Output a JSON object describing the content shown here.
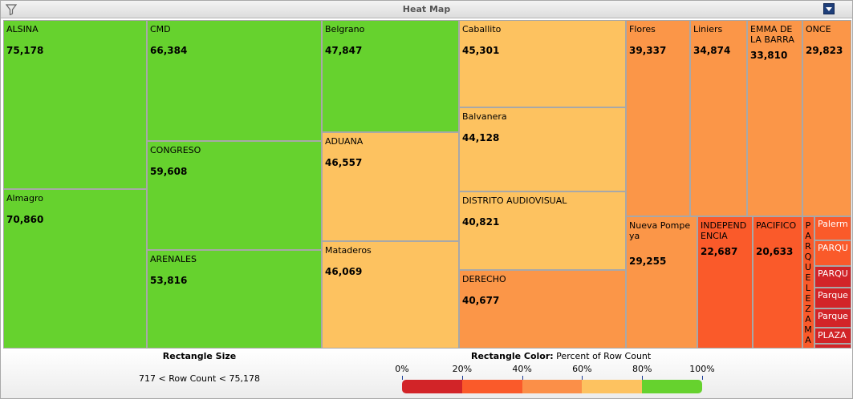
{
  "window": {
    "title": "Heat Map"
  },
  "legend": {
    "size_heading": "Rectangle Size",
    "size_text": "717 < Row Count < 75,178",
    "color_heading": "Rectangle Color:",
    "color_measure": " Percent of Row Count",
    "ticks": [
      "0%",
      "20%",
      "40%",
      "60%",
      "80%",
      "100%"
    ],
    "colors": [
      "#d22428",
      "#fa5a2a",
      "#fb8f48",
      "#fdc260",
      "#66d22e"
    ]
  },
  "chart_data": {
    "type": "treemap",
    "title": "Heat Map",
    "size_measure": "Row Count",
    "size_range": [
      717,
      75178
    ],
    "color_measure": "Percent of Row Count",
    "color_scale": [
      {
        "from": 0,
        "to": 20,
        "color": "#d22428"
      },
      {
        "from": 20,
        "to": 40,
        "color": "#fa5a2a"
      },
      {
        "from": 40,
        "to": 60,
        "color": "#fb8f48"
      },
      {
        "from": 60,
        "to": 80,
        "color": "#fdc260"
      },
      {
        "from": 80,
        "to": 100,
        "color": "#66d22e"
      }
    ],
    "items": [
      {
        "label": "ALSINA",
        "value": 75178,
        "value_text": "75,178",
        "color": "#66d22e"
      },
      {
        "label": "Almagro",
        "value": 70860,
        "value_text": "70,860",
        "color": "#66d22e"
      },
      {
        "label": "CMD",
        "value": 66384,
        "value_text": "66,384",
        "color": "#66d22e"
      },
      {
        "label": "CONGRESO",
        "value": 59608,
        "value_text": "59,608",
        "color": "#66d22e"
      },
      {
        "label": "ARENALES",
        "value": 53816,
        "value_text": "53,816",
        "color": "#66d22e"
      },
      {
        "label": "Belgrano",
        "value": 47847,
        "value_text": "47,847",
        "color": "#66d22e"
      },
      {
        "label": "ADUANA",
        "value": 46557,
        "value_text": "46,557",
        "color": "#fdc260"
      },
      {
        "label": "Mataderos",
        "value": 46069,
        "value_text": "46,069",
        "color": "#fdc260"
      },
      {
        "label": "Caballito",
        "value": 45301,
        "value_text": "45,301",
        "color": "#fdc260"
      },
      {
        "label": "Balvanera",
        "value": 44128,
        "value_text": "44,128",
        "color": "#fdc260"
      },
      {
        "label": "DISTRITO AUDIOVISUAL",
        "value": 40821,
        "value_text": "40,821",
        "color": "#fdc260"
      },
      {
        "label": "DERECHO",
        "value": 40677,
        "value_text": "40,677",
        "color": "#fb9648"
      },
      {
        "label": "Flores",
        "value": 39337,
        "value_text": "39,337",
        "color": "#fb9648"
      },
      {
        "label": "Liniers",
        "value": 34874,
        "value_text": "34,874",
        "color": "#fb9648"
      },
      {
        "label": "EMMA DE LA BARRA",
        "value": 33810,
        "value_text": "33,810",
        "color": "#fb9648"
      },
      {
        "label": "ONCE",
        "value": 29823,
        "value_text": "29,823",
        "color": "#fb9648"
      },
      {
        "label": "Nueva Pompeya",
        "value": 29255,
        "value_text": "29,255",
        "color": "#fb9648"
      },
      {
        "label": "INDEPENDENCIA",
        "value": 22687,
        "value_text": "22,687",
        "color": "#fa5a2a"
      },
      {
        "label": "PACIFICO",
        "value": 20633,
        "value_text": "20,633",
        "color": "#fa5a2a"
      },
      {
        "label": "PARQUE LEZAMA",
        "value": null,
        "value_text": "",
        "color": "#fa5a2a"
      },
      {
        "label": "Palerm",
        "value": null,
        "value_text": "",
        "color": "#fa5a2a"
      },
      {
        "label": "PARQU",
        "value": null,
        "value_text": "",
        "color": "#fa5a2a"
      },
      {
        "label": "PARQU",
        "value": null,
        "value_text": "",
        "color": "#d22428"
      },
      {
        "label": "Parque",
        "value": null,
        "value_text": "",
        "color": "#d22428"
      },
      {
        "label": "Parque",
        "value": null,
        "value_text": "",
        "color": "#d22428"
      },
      {
        "label": "PLAZA",
        "value": null,
        "value_text": "",
        "color": "#d22428"
      },
      {
        "label": "",
        "value": null,
        "value_text": "",
        "color": "#d22428"
      }
    ]
  }
}
